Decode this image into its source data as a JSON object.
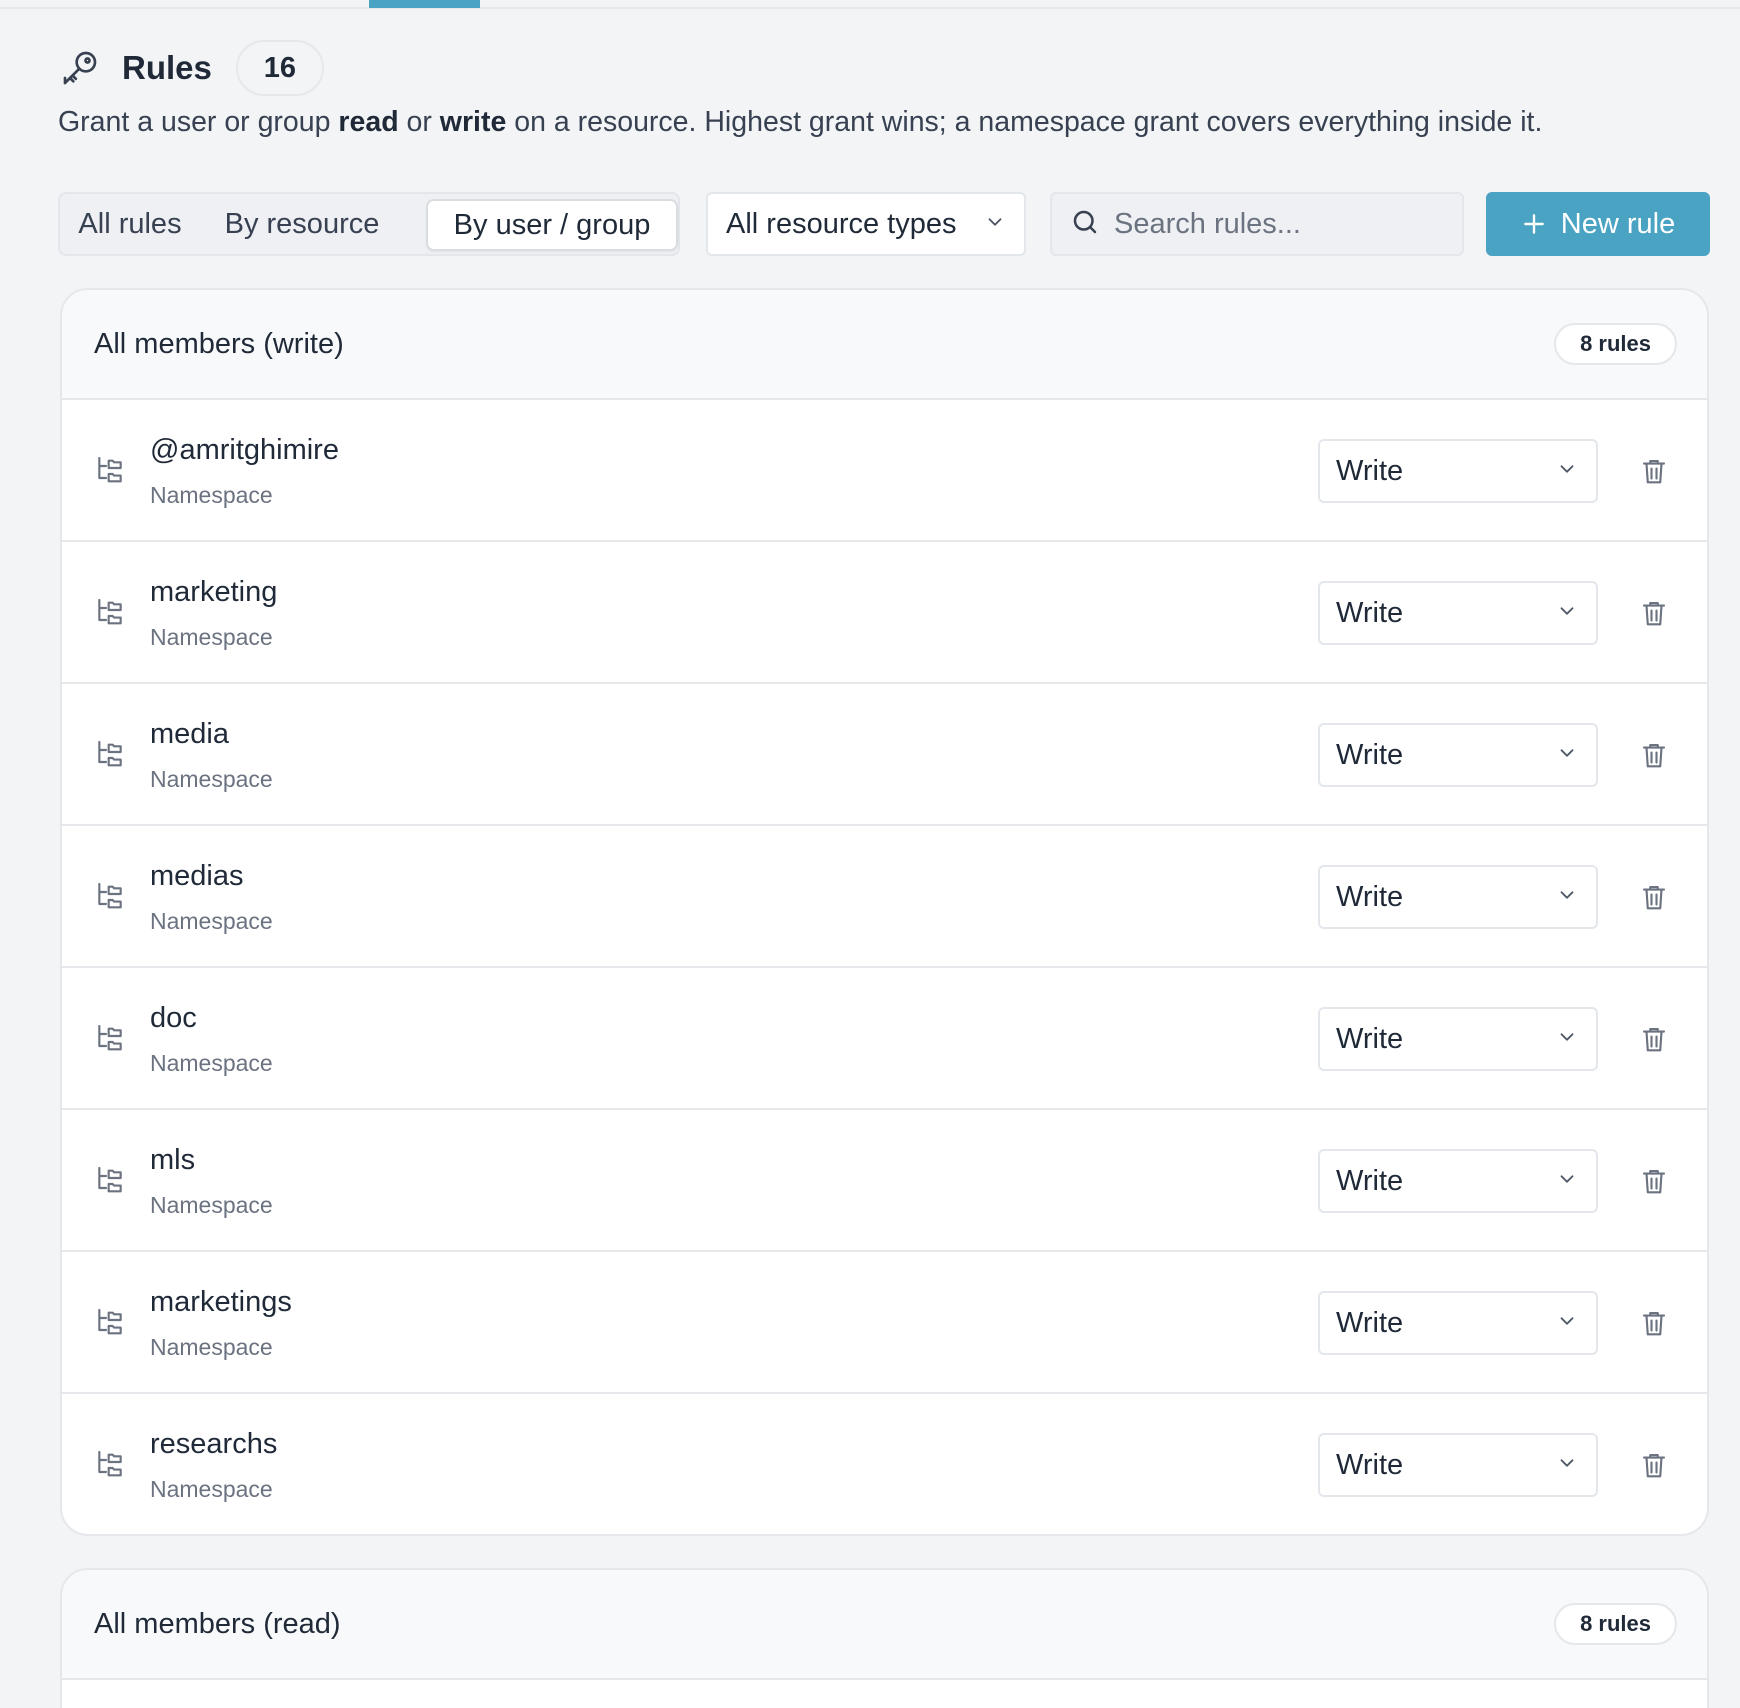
{
  "header": {
    "title": "Rules",
    "count": "16",
    "description_parts": [
      "Grant a user or group ",
      "read",
      " or ",
      "write",
      " on a resource. Highest grant wins; a namespace grant covers everything inside it."
    ]
  },
  "toolbar": {
    "tabs": [
      "All rules",
      "By resource",
      "By user / group"
    ],
    "active_tab": "By user / group",
    "type_filter": "All resource types",
    "search_placeholder": "Search rules...",
    "new_rule_label": "New rule"
  },
  "colors": {
    "accent": "#4ba3c3"
  },
  "groups": [
    {
      "title": "All members (write)",
      "badge": "8 rules",
      "rules": [
        {
          "name": "@amritghimire",
          "type": "Namespace",
          "permission": "Write"
        },
        {
          "name": "marketing",
          "type": "Namespace",
          "permission": "Write"
        },
        {
          "name": "media",
          "type": "Namespace",
          "permission": "Write"
        },
        {
          "name": "medias",
          "type": "Namespace",
          "permission": "Write"
        },
        {
          "name": "doc",
          "type": "Namespace",
          "permission": "Write"
        },
        {
          "name": "mls",
          "type": "Namespace",
          "permission": "Write"
        },
        {
          "name": "marketings",
          "type": "Namespace",
          "permission": "Write"
        },
        {
          "name": "researchs",
          "type": "Namespace",
          "permission": "Write"
        }
      ]
    },
    {
      "title": "All members (read)",
      "badge": "8 rules"
    }
  ],
  "icons": {
    "header": "key-icon",
    "row": "namespace-tree-icon",
    "delete": "trash-icon",
    "select": "chevron-down-icon",
    "search": "search-icon",
    "add": "plus-icon"
  }
}
